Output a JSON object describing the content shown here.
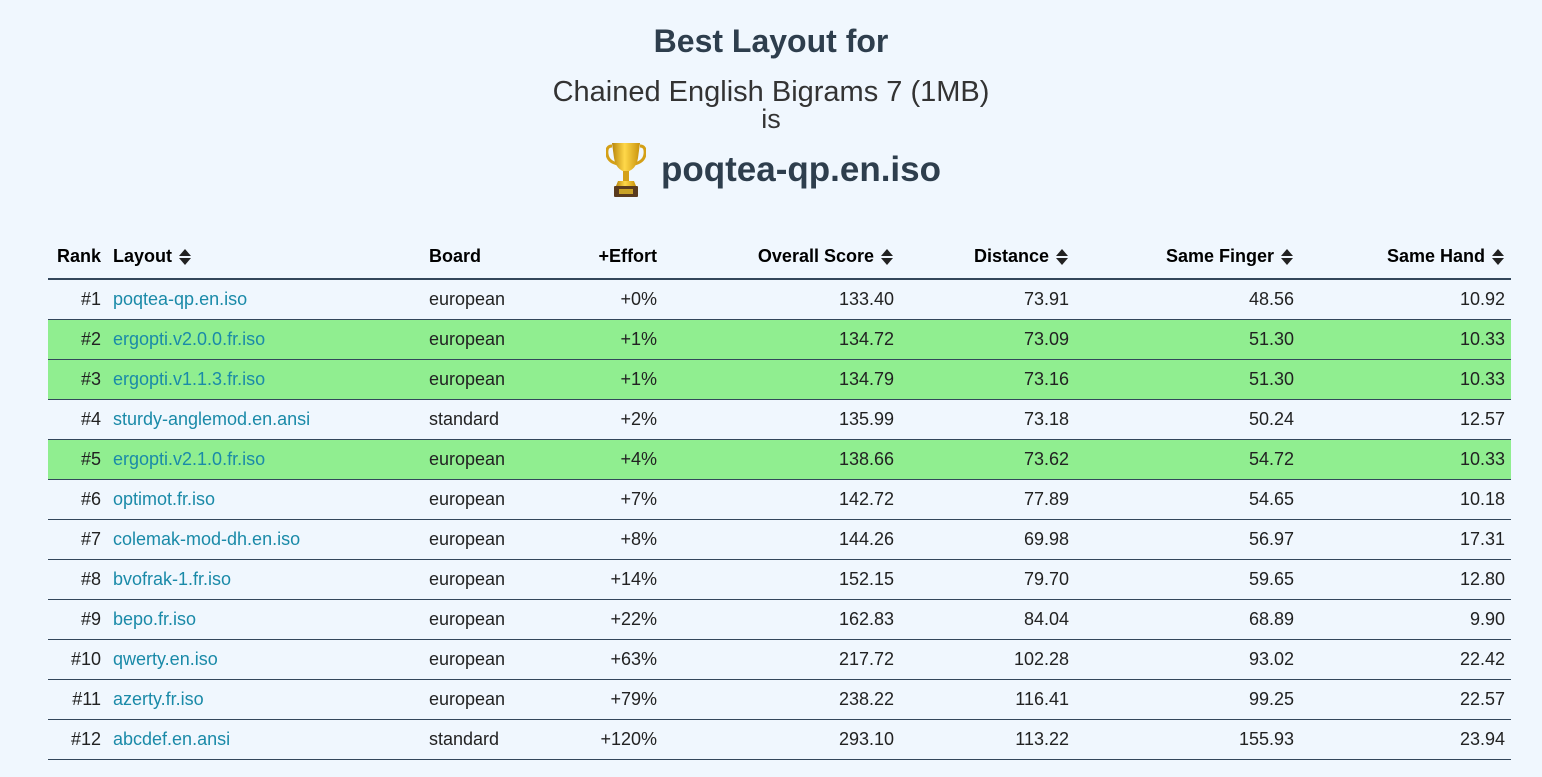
{
  "header": {
    "title": "Best Layout for",
    "corpus": "Chained English Bigrams 7 (1MB)",
    "is_text": "is",
    "winner": "poqtea-qp.en.iso",
    "trophy_icon": "trophy-icon"
  },
  "table": {
    "columns": {
      "rank": "Rank",
      "layout": "Layout",
      "board": "Board",
      "effort": "+Effort",
      "overall": "Overall Score",
      "distance": "Distance",
      "same_finger": "Same Finger",
      "same_hand": "Same Hand"
    },
    "highlight_color": "#90ee90",
    "rows": [
      {
        "rank": "#1",
        "layout": "poqtea-qp.en.iso",
        "board": "european",
        "effort": "+0%",
        "overall": "133.40",
        "distance": "73.91",
        "same_finger": "48.56",
        "same_hand": "10.92",
        "highlight": false
      },
      {
        "rank": "#2",
        "layout": "ergopti.v2.0.0.fr.iso",
        "board": "european",
        "effort": "+1%",
        "overall": "134.72",
        "distance": "73.09",
        "same_finger": "51.30",
        "same_hand": "10.33",
        "highlight": true
      },
      {
        "rank": "#3",
        "layout": "ergopti.v1.1.3.fr.iso",
        "board": "european",
        "effort": "+1%",
        "overall": "134.79",
        "distance": "73.16",
        "same_finger": "51.30",
        "same_hand": "10.33",
        "highlight": true
      },
      {
        "rank": "#4",
        "layout": "sturdy-anglemod.en.ansi",
        "board": "standard",
        "effort": "+2%",
        "overall": "135.99",
        "distance": "73.18",
        "same_finger": "50.24",
        "same_hand": "12.57",
        "highlight": false
      },
      {
        "rank": "#5",
        "layout": "ergopti.v2.1.0.fr.iso",
        "board": "european",
        "effort": "+4%",
        "overall": "138.66",
        "distance": "73.62",
        "same_finger": "54.72",
        "same_hand": "10.33",
        "highlight": true
      },
      {
        "rank": "#6",
        "layout": "optimot.fr.iso",
        "board": "european",
        "effort": "+7%",
        "overall": "142.72",
        "distance": "77.89",
        "same_finger": "54.65",
        "same_hand": "10.18",
        "highlight": false
      },
      {
        "rank": "#7",
        "layout": "colemak-mod-dh.en.iso",
        "board": "european",
        "effort": "+8%",
        "overall": "144.26",
        "distance": "69.98",
        "same_finger": "56.97",
        "same_hand": "17.31",
        "highlight": false
      },
      {
        "rank": "#8",
        "layout": "bvofrak-1.fr.iso",
        "board": "european",
        "effort": "+14%",
        "overall": "152.15",
        "distance": "79.70",
        "same_finger": "59.65",
        "same_hand": "12.80",
        "highlight": false
      },
      {
        "rank": "#9",
        "layout": "bepo.fr.iso",
        "board": "european",
        "effort": "+22%",
        "overall": "162.83",
        "distance": "84.04",
        "same_finger": "68.89",
        "same_hand": "9.90",
        "highlight": false
      },
      {
        "rank": "#10",
        "layout": "qwerty.en.iso",
        "board": "european",
        "effort": "+63%",
        "overall": "217.72",
        "distance": "102.28",
        "same_finger": "93.02",
        "same_hand": "22.42",
        "highlight": false
      },
      {
        "rank": "#11",
        "layout": "azerty.fr.iso",
        "board": "european",
        "effort": "+79%",
        "overall": "238.22",
        "distance": "116.41",
        "same_finger": "99.25",
        "same_hand": "22.57",
        "highlight": false
      },
      {
        "rank": "#12",
        "layout": "abcdef.en.ansi",
        "board": "standard",
        "effort": "+120%",
        "overall": "293.10",
        "distance": "113.22",
        "same_finger": "155.93",
        "same_hand": "23.94",
        "highlight": false
      }
    ]
  }
}
